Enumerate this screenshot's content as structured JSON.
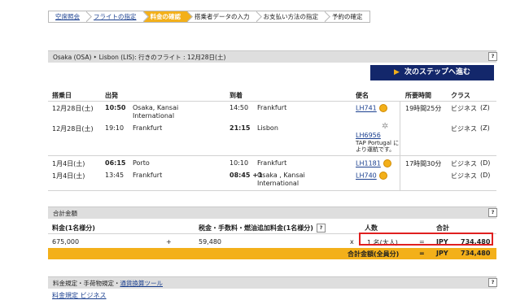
{
  "steps": [
    {
      "label": "空席照会"
    },
    {
      "label": "フライトの指定"
    },
    {
      "label": "料金の確認"
    },
    {
      "label": "搭乗者データの入力"
    },
    {
      "label": "お支払い方法の指定"
    },
    {
      "label": "予約の確定"
    }
  ],
  "route_title": "Osaka (OSA) ‣ Lisbon (LIS): 行きのフライト : 12月28日(土)",
  "help": "?",
  "next_button": "次のステップへ進む",
  "headers": {
    "date": "搭乗日",
    "dep": "出発",
    "arr": "到着",
    "flight": "便名",
    "duration": "所要時間",
    "class": "クラス"
  },
  "segments": [
    {
      "date": "12月28日(土)",
      "dep_time": "10:50",
      "dep_place": "Osaka, Kansai",
      "dep_place2": "International",
      "arr_time": "14:50",
      "arr_place": "Frankfurt",
      "flight": "LH741",
      "duration": "19時間25分",
      "class": "ビジネス",
      "code": "(Z)"
    },
    {
      "date": "12月28日(土)",
      "dep_time": "19:10",
      "dep_place": "Frankfurt",
      "arr_time": "21:15",
      "arr_place": "Lisbon",
      "flight": "LH6956",
      "note": "TAP Portugal に",
      "note2": "より運航です。",
      "class": "ビジネス",
      "code": "(Z)"
    },
    {
      "date": "1月4日(土)",
      "dep_time": "06:15",
      "dep_place": "Porto",
      "arr_time": "10:10",
      "arr_place": "Frankfurt",
      "flight": "LH1181",
      "duration": "17時間30分",
      "class": "ビジネス",
      "code": "(D)"
    },
    {
      "date": "1月4日(土)",
      "dep_time": "13:45",
      "dep_place": "Frankfurt",
      "arr_time": "08:45 +1",
      "arr_place": "Osaka , Kansai",
      "arr_place2": "International",
      "flight": "LH740",
      "class": "ビジネス",
      "code": "(D)"
    }
  ],
  "total_title": "合計金額",
  "fare": {
    "label": "料金(1名様分)",
    "value": "675,000",
    "plus": "+",
    "tax_label": "税金・手数料・燃油追加料金(1名様分)",
    "tax_value": "59,480",
    "times": "x",
    "pax_label": "人数",
    "pax_value": "1 名(大人)",
    "eq": "=",
    "total_label": "合計",
    "currency": "JPY",
    "total_value": "734,480"
  },
  "grand": {
    "label": "合計金額(全員分)",
    "eq": "=",
    "currency": "JPY",
    "value": "734,480"
  },
  "rules_title": {
    "part1": "料金規定・手荷物規定・",
    "link": "通貨換算ツール"
  },
  "rules_link": "料金規定 ビジネス"
}
